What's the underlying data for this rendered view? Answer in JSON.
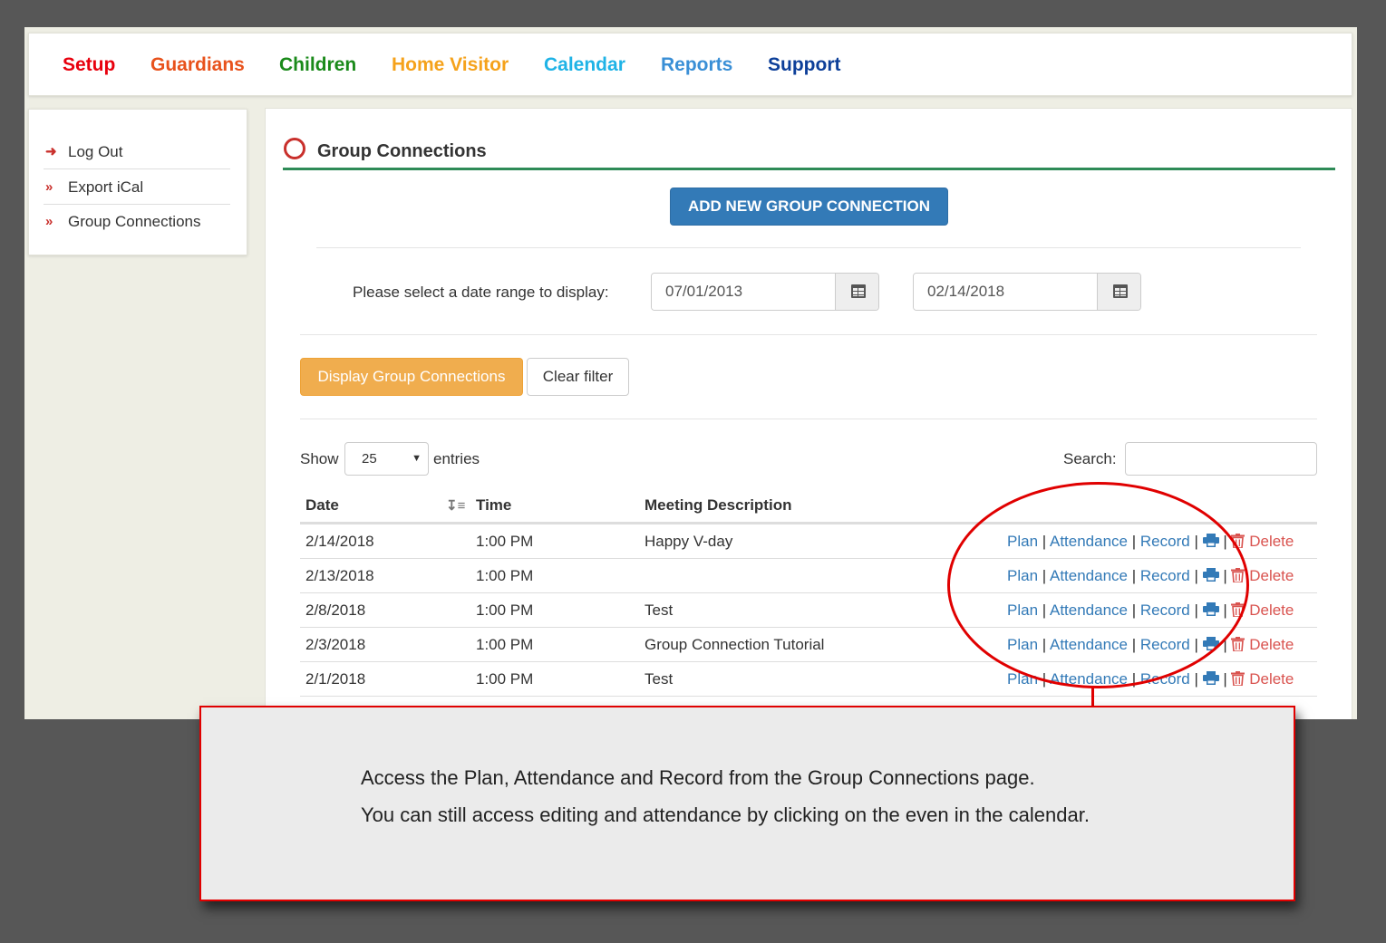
{
  "nav": [
    {
      "label": "Setup",
      "color": "#e8000d"
    },
    {
      "label": "Guardians",
      "color": "#e8521c"
    },
    {
      "label": "Children",
      "color": "#1a8a1a"
    },
    {
      "label": "Home Visitor",
      "color": "#f5a21b"
    },
    {
      "label": "Calendar",
      "color": "#1fb3e6"
    },
    {
      "label": "Reports",
      "color": "#3a8fd6"
    },
    {
      "label": "Support",
      "color": "#0d3f99"
    }
  ],
  "sidebar": [
    {
      "label": "Log Out",
      "icon": "sign-out-icon"
    },
    {
      "label": "Export iCal",
      "icon": "double-chevron-icon"
    },
    {
      "label": "Group Connections",
      "icon": "double-chevron-icon"
    }
  ],
  "section": {
    "title": "Group Connections"
  },
  "add_button": "ADD NEW GROUP CONNECTION",
  "filter": {
    "label": "Please select a date range to display:",
    "start_date": "07/01/2013",
    "end_date": "02/14/2018",
    "display_button": "Display Group Connections",
    "clear_button": "Clear filter"
  },
  "table_controls": {
    "show_label": "Show",
    "entries_value": "25",
    "entries_label": "entries",
    "search_label": "Search:"
  },
  "table": {
    "headers": [
      "Date",
      "Time",
      "Meeting Description"
    ],
    "action_labels": {
      "plan": "Plan",
      "attendance": "Attendance",
      "record": "Record",
      "delete": "Delete",
      "separator": "|"
    },
    "rows": [
      {
        "date": "2/14/2018",
        "time": "1:00 PM",
        "description": "Happy V-day"
      },
      {
        "date": "2/13/2018",
        "time": "1:00 PM",
        "description": ""
      },
      {
        "date": "2/8/2018",
        "time": "1:00 PM",
        "description": "Test"
      },
      {
        "date": "2/3/2018",
        "time": "1:00 PM",
        "description": "Group Connection Tutorial"
      },
      {
        "date": "2/1/2018",
        "time": "1:00 PM",
        "description": "Test"
      }
    ]
  },
  "callout": {
    "line1": "Access the Plan, Attendance and Record from the Group Connections page.",
    "line2": "You can still  access editing and attendance by clicking on the even in the calendar."
  },
  "colors": {
    "primary": "#337ab7",
    "warning": "#f0ad4e",
    "danger": "#d9534f",
    "accent_red": "#e00000",
    "section_rule": "#2e8b57"
  }
}
